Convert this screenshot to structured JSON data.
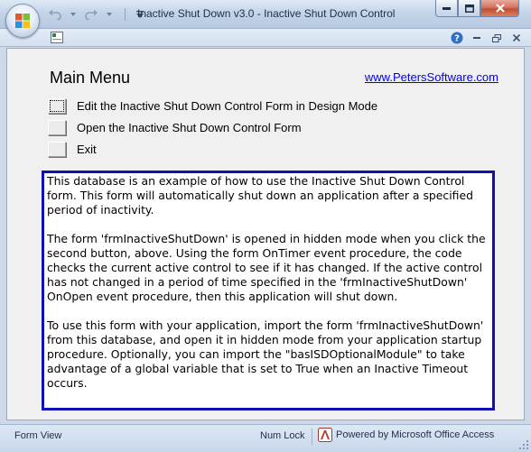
{
  "window": {
    "title": "Inactive Shut Down v3.0 - Inactive Shut Down Control"
  },
  "quick_access": {
    "undo_icon": "undo-arrow",
    "redo_icon": "redo-arrow",
    "customize_icon": "chevron-down"
  },
  "form": {
    "menu_title": "Main Menu",
    "website_link": "www.PetersSoftware.com",
    "menu_items": [
      {
        "label": "Edit the Inactive Shut Down Control Form in Design Mode"
      },
      {
        "label": "Open the Inactive Shut Down Control Form"
      },
      {
        "label": "Exit"
      }
    ],
    "description": [
      "This database is an example of how to use the Inactive Shut Down Control form. This form will automatically shut down an application after a specified period of inactivity.",
      "The form 'frmInactiveShutDown' is opened in hidden mode when you click the second button, above. Using the form OnTimer event procedure, the code checks the current active control to see if it has changed. If the active control has not changed in a period of time specified in the 'frmInactiveShutDown' OnOpen event procedure, then this application will shut down.",
      "To use this form with your application, import the form 'frmInactiveShutDown' from this database, and open it in hidden mode from your application startup procedure. Optionally, you can import the \"basISDOptionalModule\" to take advantage of a global variable that is set to True when an Inactive Timeout occurs."
    ]
  },
  "statusbar": {
    "view": "Form View",
    "numlock": "Num Lock",
    "powered_by": "Powered by Microsoft Office Access"
  },
  "colors": {
    "description_border": "#1010b4",
    "link": "#0000ff"
  }
}
